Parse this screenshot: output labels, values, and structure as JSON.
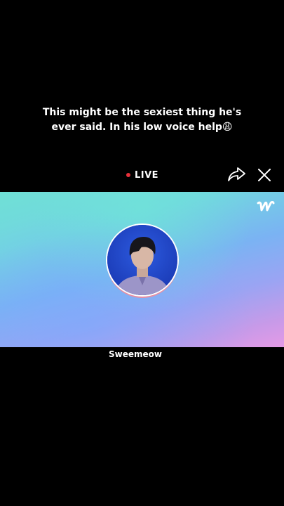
{
  "caption": {
    "line1": "This might be the sexiest thing he's",
    "line2": "ever said. In his low voice help😩"
  },
  "live": {
    "label": "LIVE",
    "dot_color": "#e8303a"
  },
  "controls": {
    "share_icon": "share-arrow-icon",
    "close_icon": "close-icon"
  },
  "banner": {
    "logo_letter": "w",
    "logo_icon": "weverse-logo-icon"
  },
  "profile": {
    "username": "Sweemeow"
  }
}
